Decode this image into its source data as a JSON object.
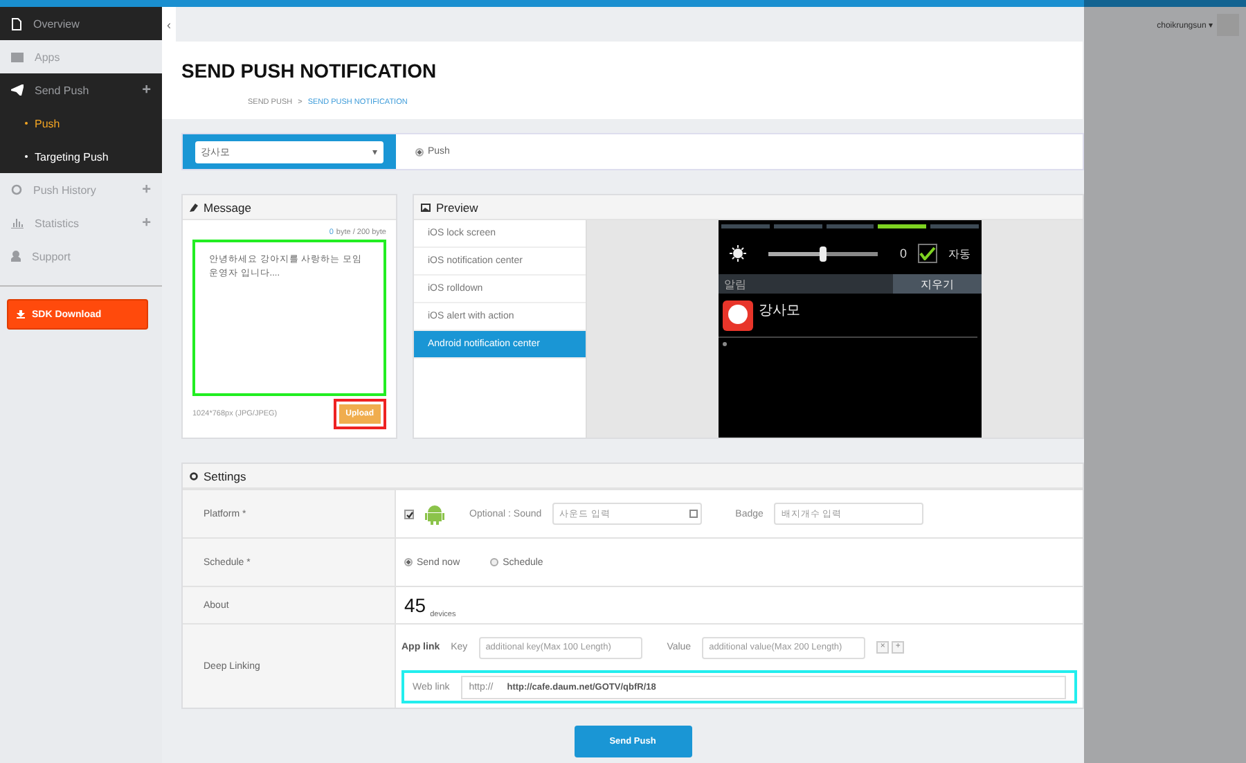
{
  "sidebar": {
    "items": [
      {
        "label": "Overview",
        "active": true
      },
      {
        "label": "Apps",
        "active": false
      },
      {
        "label": "Send Push",
        "active": true,
        "toggle": "+",
        "children": [
          {
            "label": "Push",
            "selected": true
          },
          {
            "label": "Targeting Push",
            "selected": false
          }
        ]
      },
      {
        "label": "Push History",
        "active": false,
        "toggle": "+"
      },
      {
        "label": "Statistics",
        "active": false,
        "toggle": "+"
      },
      {
        "label": "Support",
        "active": false
      }
    ],
    "download_button": "SDK Download"
  },
  "header": {
    "collapse": "‹",
    "user": "choikrungsun",
    "user_caret": "▾"
  },
  "page": {
    "title": "SEND PUSH NOTIFICATION",
    "breadcrumb": [
      {
        "label": "SEND PUSH",
        "current": false
      },
      {
        "label": "SEND PUSH NOTIFICATION",
        "current": true
      }
    ],
    "separator": ">"
  },
  "app_bar": {
    "app_select": "강사모",
    "app_select_caret": "▾",
    "push_types": [
      {
        "label": "Push",
        "selected": true
      }
    ]
  },
  "message": {
    "title": "Message",
    "count": "0",
    "limit": "byte / 200 byte",
    "text": "안녕하세요 강아지를 사랑하는 모임\n운영자 입니다....",
    "image_hint": "1024*768px (JPG/JPEG)",
    "upload": "Upload"
  },
  "preview": {
    "title": "Preview",
    "tabs": [
      {
        "label": "iOS lock screen",
        "selected": false
      },
      {
        "label": "iOS notification center",
        "selected": false
      },
      {
        "label": "iOS rolldown",
        "selected": false
      },
      {
        "label": "iOS alert with action",
        "selected": false
      },
      {
        "label": "Android notification center",
        "selected": true
      }
    ],
    "phone": {
      "brightness": {
        "level": 0.5
      },
      "brightness_value": "0",
      "auto": {
        "checked": true,
        "label": "자동"
      },
      "panel_title": "알림",
      "clear": "지우기",
      "notification_title": "강사모"
    }
  },
  "settings": {
    "title": "Settings",
    "platform": {
      "label": "Platform *",
      "android_checked": true,
      "sound_label": "Optional : Sound",
      "sound_placeholder": "사운드 입력",
      "badge_label": "Badge",
      "badge_placeholder": "배지개수 입력"
    },
    "schedule": {
      "label": "Schedule *",
      "options": [
        {
          "label": "Send now",
          "selected": true
        },
        {
          "label": "Schedule",
          "selected": false
        }
      ]
    },
    "about": {
      "label": "About",
      "count": "45",
      "unit": "devices"
    },
    "deep_linking": {
      "label": "Deep Linking",
      "app_link": "App link",
      "key_label": "Key",
      "key_placeholder": "additional key(Max 100 Length)",
      "value_label": "Value",
      "value_placeholder": "additional value(Max 200 Length)",
      "remove": "×",
      "add": "+",
      "web_link": "Web link",
      "prefix": "http://",
      "url": "http://cafe.daum.net/GOTV/qbfR/18"
    }
  },
  "send_button": "Send Push"
}
